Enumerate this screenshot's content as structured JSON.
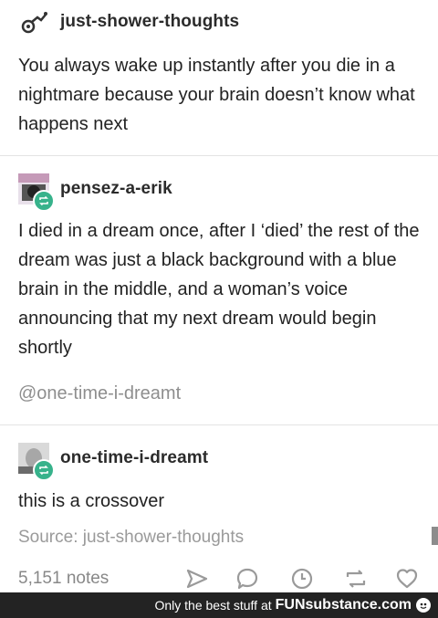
{
  "posts": [
    {
      "username": "just-shower-thoughts",
      "body": "You always wake up instantly after you die in a nightmare because your brain doesn’t know what happens next"
    },
    {
      "username": "pensez-a-erik",
      "body": "I died in a dream once, after I ‘died’ the rest of the dream was just a black background with a blue brain in the middle, and a woman’s voice announcing that my next dream would begin shortly",
      "mention": "@one-time-i-dreamt"
    },
    {
      "username": "one-time-i-dreamt",
      "body": "this is a crossover",
      "source": "Source: just-shower-thoughts"
    }
  ],
  "footer": {
    "notes": "5,151 notes",
    "icons": [
      "share-icon",
      "reply-icon",
      "clock-icon",
      "reblog-icon",
      "heart-icon"
    ]
  },
  "watermark": {
    "text": "Only the best stuff at",
    "brand": "FUNsubstance.com"
  },
  "colors": {
    "reblog_green": "#37b28b",
    "text": "#222222",
    "muted": "#8e8e8e",
    "watermark_bg": "#232323"
  }
}
